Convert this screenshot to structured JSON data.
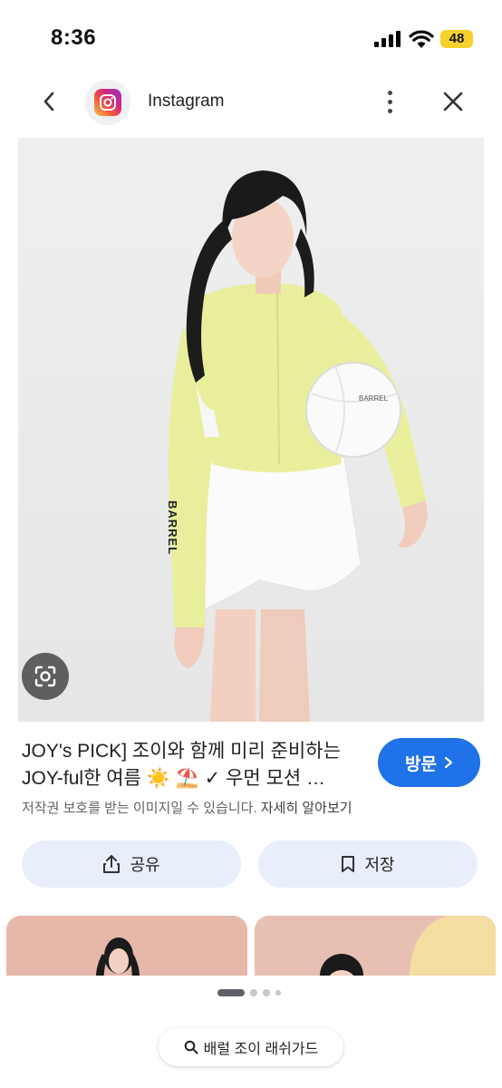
{
  "status_bar": {
    "time": "8:36",
    "battery": "48"
  },
  "header": {
    "app_name": "Instagram",
    "icons": [
      "back-icon",
      "instagram-logo",
      "more-vertical-icon",
      "close-icon"
    ]
  },
  "image": {
    "brand_text_sleeve": "BARREL",
    "brand_text_ball": "BARREL"
  },
  "result": {
    "title_line1": "JOY's PICK] 조이와 함께 미리 준비하는",
    "title_line2": "JOY-ful한 여름 ☀️ ⛱️ ✓ 우먼 모션 …",
    "visit_label": "방문",
    "copyright_text": "저작권 보호를 받는 이미지일 수 있습니다.",
    "copyright_link": "자세히 알아보기"
  },
  "actions": {
    "share_label": "공유",
    "save_label": "저장"
  },
  "search": {
    "query": "배럴 조이 래쉬가드"
  },
  "colors": {
    "accent": "#1f72e8",
    "action_bg": "#e8eefa",
    "jacket": "#e9ee9c"
  }
}
